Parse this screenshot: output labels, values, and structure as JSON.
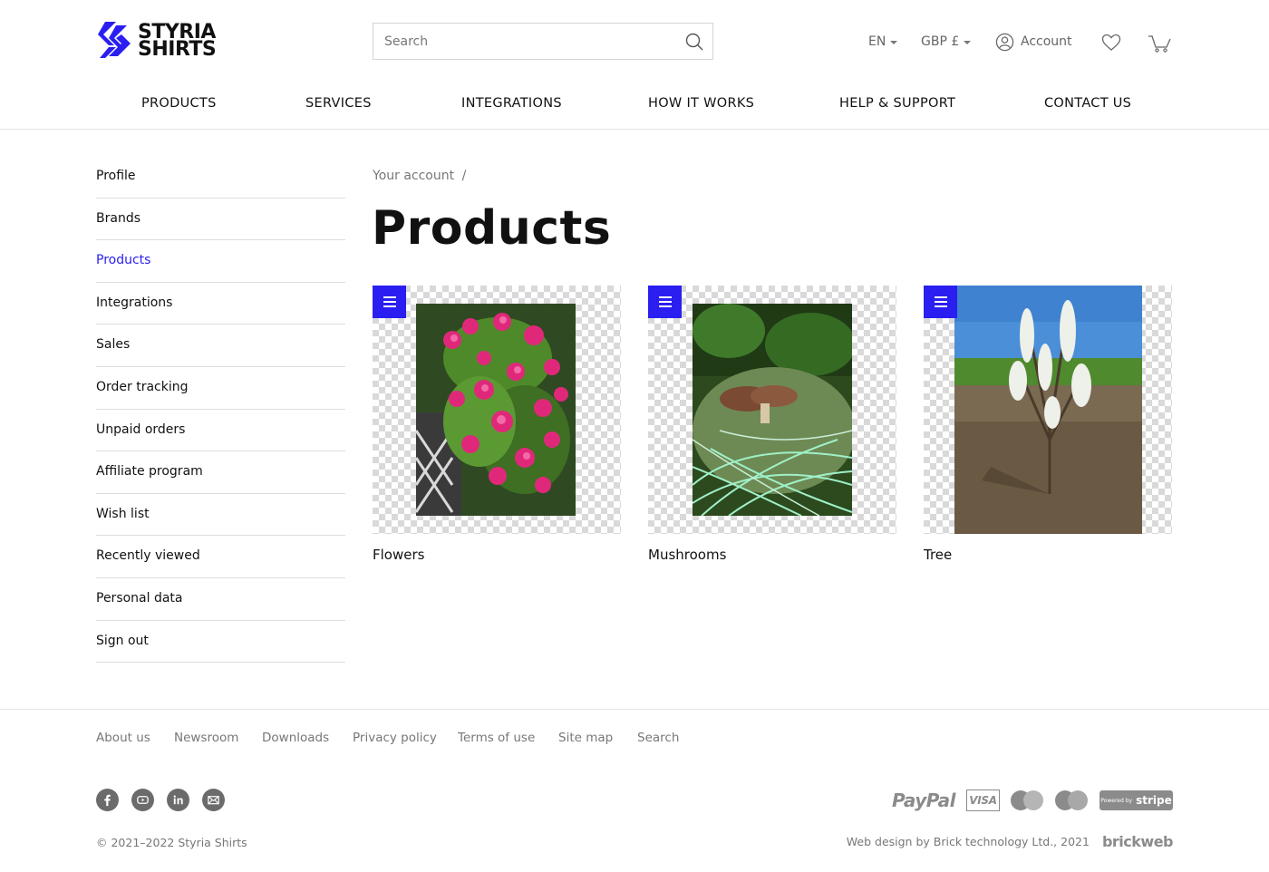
{
  "brand": {
    "line1": "STYRIA",
    "line2": "SHIRTS",
    "accent": "#2a1ff0"
  },
  "search": {
    "placeholder": "Search",
    "value": ""
  },
  "top": {
    "language": "EN",
    "currency": "GBP £",
    "account_label": "Account"
  },
  "nav": [
    "PRODUCTS",
    "SERVICES",
    "INTEGRATIONS",
    "HOW IT WORKS",
    "HELP & SUPPORT",
    "CONTACT US"
  ],
  "sidebar": {
    "active": "Products",
    "items": [
      "Profile",
      "Brands",
      "Products",
      "Integrations",
      "Sales",
      "Order tracking",
      "Unpaid orders",
      "Affiliate program",
      "Wish list",
      "Recently viewed",
      "Personal data",
      "Sign out"
    ]
  },
  "breadcrumb": {
    "parent": "Your account",
    "separator": "/"
  },
  "page": {
    "title": "Products"
  },
  "products": [
    {
      "name": "Flowers",
      "icon": "menu-icon"
    },
    {
      "name": "Mushrooms",
      "icon": "menu-icon"
    },
    {
      "name": "Tree",
      "icon": "menu-icon"
    }
  ],
  "footer": {
    "links": [
      "About us",
      "Newsroom",
      "Downloads",
      "Privacy policy",
      "Terms of use",
      "Site map",
      "Search"
    ],
    "social": [
      "facebook-icon",
      "youtube-icon",
      "linkedin-icon",
      "email-icon"
    ],
    "payments": {
      "paypal": "PayPal",
      "visa": "VISA",
      "stripe_prefix": "Powered by",
      "stripe": "stripe"
    },
    "copyright": "© 2021–2022 Styria Shirts",
    "credit": "Web design by Brick technology Ltd., 2021",
    "credit_logo": "brickweb"
  }
}
